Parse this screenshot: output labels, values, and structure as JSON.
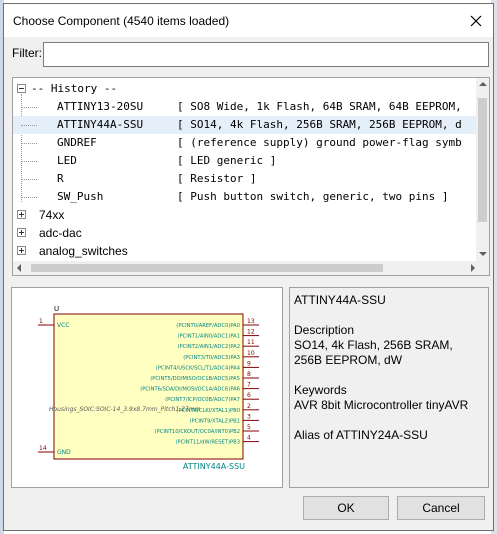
{
  "dialog": {
    "title": "Choose Component (4540 items loaded)"
  },
  "filter": {
    "label": "Filter:",
    "value": "",
    "placeholder": ""
  },
  "tree": {
    "history_label": "-- History --",
    "history_items": [
      {
        "name": "ATTINY13-20SU",
        "desc": "[ SO8 Wide, 1k Flash, 64B SRAM, 64B EEPROM,"
      },
      {
        "name": "ATTINY44A-SSU",
        "desc": "[ SO14, 4k Flash, 256B SRAM, 256B EEPROM, d"
      },
      {
        "name": "GNDREF",
        "desc": "[ (reference supply) ground power-flag symb"
      },
      {
        "name": "LED",
        "desc": "[ LED generic ]"
      },
      {
        "name": "R",
        "desc": "[ Resistor ]"
      },
      {
        "name": "SW_Push",
        "desc": "[ Push button switch, generic, two pins ]"
      }
    ],
    "groups": [
      "74xx",
      "adc-dac",
      "analog_switches"
    ]
  },
  "preview": {
    "ref": "U",
    "part": "ATTINY44A-SSU",
    "footprint": "Housings_SOIC:SOIC-14_3.9x8.7mm_Pitch1.27mm",
    "left_pins": [
      {
        "num": "1",
        "name": "VCC"
      },
      {
        "num": "14",
        "name": "GND"
      }
    ],
    "right_pins": [
      {
        "num": "13",
        "name": "(PCINT0/AREF/ADC0)PA0"
      },
      {
        "num": "12",
        "name": "(PCINT1/AIN0/ADC1)PA1"
      },
      {
        "num": "11",
        "name": "(PCINT2/AIN1/ADC2)PA2"
      },
      {
        "num": "10",
        "name": "(PCINT3/T0/ADC3)PA3"
      },
      {
        "num": "9",
        "name": "(PCINT4/USCK/SCL/T1/ADC4)PA4"
      },
      {
        "num": "8",
        "name": "(PCINT5/DO/MISO/OC1B/ADC5)PA5"
      },
      {
        "num": "7",
        "name": "(PCINT6/SDA/DI/MOSI/OC1A/ADC6)PA6"
      },
      {
        "num": "6",
        "name": "(PCINT7/ICP/OC0B/ADC7)PA7"
      },
      {
        "num": "2",
        "name": "(PCINT8/CLKI/XTAL1)PB0"
      },
      {
        "num": "3",
        "name": "(PCINT9/XTAL2)PB1"
      },
      {
        "num": "5",
        "name": "(PCINT10/CKOUT/OC0A/INT0)PB2"
      },
      {
        "num": "4",
        "name": "(PCINT11/dW/RESET)PB3"
      }
    ]
  },
  "info": {
    "name": "ATTINY44A-SSU",
    "description_heading": "Description",
    "description": "SO14, 4k Flash, 256B SRAM, 256B EEPROM, dW",
    "keywords_heading": "Keywords",
    "keywords": "AVR 8bit Microcontroller tinyAVR",
    "alias": "Alias of ATTINY24A-SSU"
  },
  "buttons": {
    "ok": "OK",
    "cancel": "Cancel"
  },
  "colors": {
    "schematic_pin": "#840000",
    "schematic_text": "#008484",
    "schematic_body": "#ffffc2",
    "selection": "#e5eff9"
  }
}
